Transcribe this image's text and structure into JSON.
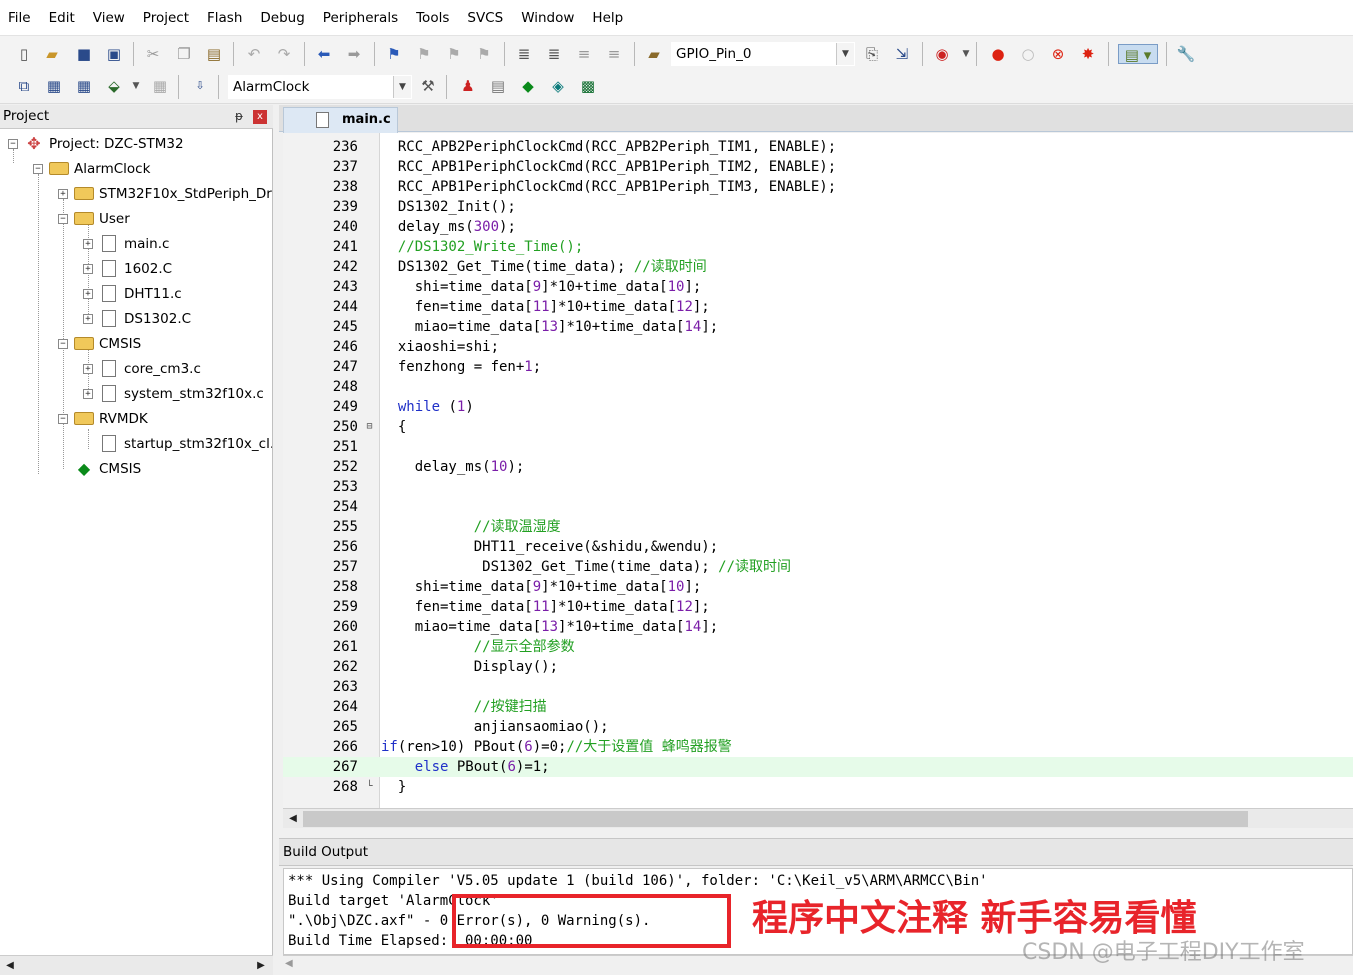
{
  "menu": [
    "File",
    "Edit",
    "View",
    "Project",
    "Flash",
    "Debug",
    "Peripherals",
    "Tools",
    "SVCS",
    "Window",
    "Help"
  ],
  "toolbar1": {
    "find_combo": "GPIO_Pin_0"
  },
  "toolbar2": {
    "target_combo": "AlarmClock"
  },
  "project_panel": {
    "title": "Project",
    "pin": "ᵽ",
    "close": "x",
    "tree": [
      {
        "label": "Project: DZC-STM32"
      },
      {
        "label": "AlarmClock"
      },
      {
        "label": "STM32F10x_StdPeriph_Dr"
      },
      {
        "label": "User"
      },
      {
        "label": "main.c"
      },
      {
        "label": "1602.C"
      },
      {
        "label": "DHT11.c"
      },
      {
        "label": "DS1302.C"
      },
      {
        "label": "CMSIS"
      },
      {
        "label": "core_cm3.c"
      },
      {
        "label": "system_stm32f10x.c"
      },
      {
        "label": "RVMDK"
      },
      {
        "label": "startup_stm32f10x_cl."
      },
      {
        "label": "CMSIS"
      }
    ]
  },
  "editor": {
    "tab": "main.c",
    "lines": [
      {
        "n": "236",
        "t": "  RCC_APB2PeriphClockCmd(RCC_APB2Periph_TIM1, ENABLE);"
      },
      {
        "n": "237",
        "t": "  RCC_APB1PeriphClockCmd(RCC_APB1Periph_TIM2, ENABLE);"
      },
      {
        "n": "238",
        "t": "  RCC_APB1PeriphClockCmd(RCC_APB1Periph_TIM3, ENABLE);"
      },
      {
        "n": "239",
        "t": "  DS1302_Init();"
      },
      {
        "n": "240",
        "t": "  delay_ms(300);"
      },
      {
        "n": "241",
        "t": "  //DS1302_Write_Time();"
      },
      {
        "n": "242",
        "t": "  DS1302_Get_Time(time_data); //读取时间"
      },
      {
        "n": "243",
        "t": "    shi=time_data[9]*10+time_data[10];"
      },
      {
        "n": "244",
        "t": "    fen=time_data[11]*10+time_data[12];"
      },
      {
        "n": "245",
        "t": "    miao=time_data[13]*10+time_data[14];"
      },
      {
        "n": "246",
        "t": "  xiaoshi=shi;"
      },
      {
        "n": "247",
        "t": "  fenzhong = fen+1;"
      },
      {
        "n": "248",
        "t": ""
      },
      {
        "n": "249",
        "t": "  while (1)"
      },
      {
        "n": "250",
        "t": "  {"
      },
      {
        "n": "251",
        "t": ""
      },
      {
        "n": "252",
        "t": "    delay_ms(10);"
      },
      {
        "n": "253",
        "t": ""
      },
      {
        "n": "254",
        "t": ""
      },
      {
        "n": "255",
        "t": "           //读取温湿度"
      },
      {
        "n": "256",
        "t": "           DHT11_receive(&shidu,&wendu);"
      },
      {
        "n": "257",
        "t": "            DS1302_Get_Time(time_data); //读取时间"
      },
      {
        "n": "258",
        "t": "    shi=time_data[9]*10+time_data[10];"
      },
      {
        "n": "259",
        "t": "    fen=time_data[11]*10+time_data[12];"
      },
      {
        "n": "260",
        "t": "    miao=time_data[13]*10+time_data[14];"
      },
      {
        "n": "261",
        "t": "           //显示全部参数"
      },
      {
        "n": "262",
        "t": "           Display();"
      },
      {
        "n": "263",
        "t": ""
      },
      {
        "n": "264",
        "t": "           //按键扫描"
      },
      {
        "n": "265",
        "t": "           anjiansaomiao();"
      },
      {
        "n": "266",
        "t": "if(ren>10) PBout(6)=0;//大于设置值 蜂鸣器报警"
      },
      {
        "n": "267",
        "t": "    else PBout(6)=1;"
      },
      {
        "n": "268",
        "t": "  }"
      }
    ]
  },
  "build_output": {
    "title": "Build Output",
    "lines": [
      "*** Using Compiler 'V5.05 update 1 (build 106)', folder: 'C:\\Keil_v5\\ARM\\ARMCC\\Bin'",
      "Build target 'AlarmClock'",
      "\".\\Obj\\DZC.axf\" - 0 Error(s), 0 Warning(s).",
      "Build Time Elapsed:  00:00:00"
    ]
  },
  "annotation": "程序中文注释 新手容易看懂",
  "watermark": "CSDN @电子工程DIY工作室",
  "colors": {
    "keyword": "#2030c8",
    "comment": "#22a022",
    "number": "#7a1ea8",
    "highlight_line": "#e6fbe9",
    "annotation": "#e8242a"
  }
}
